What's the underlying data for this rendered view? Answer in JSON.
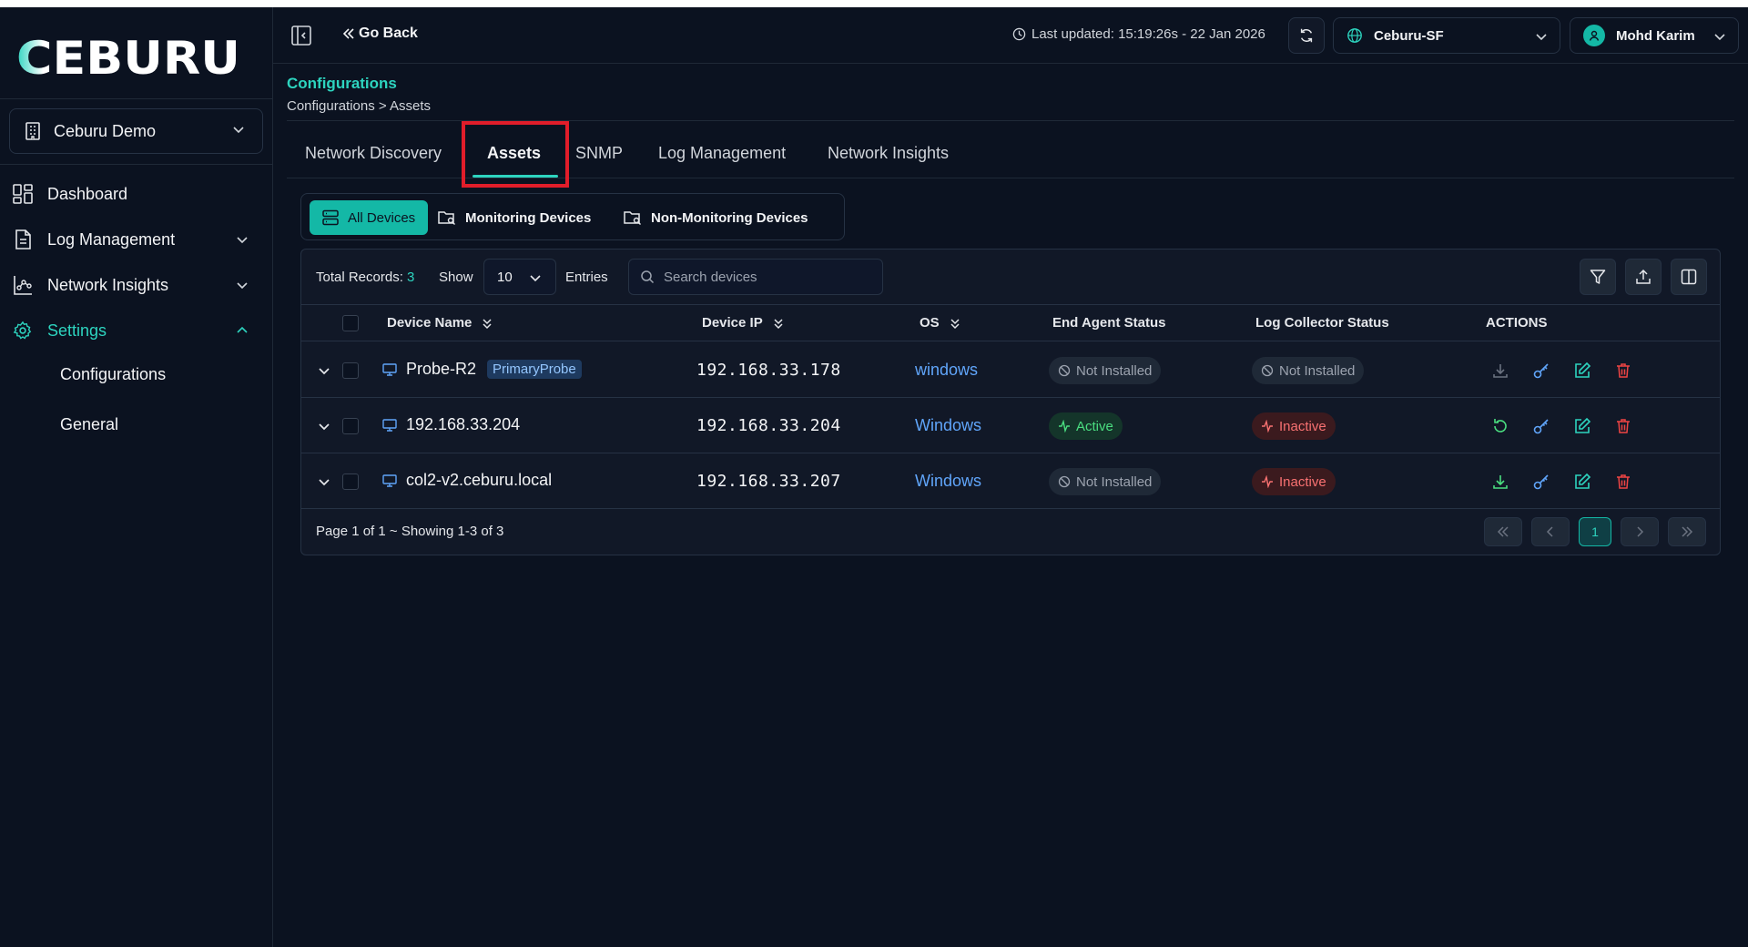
{
  "brand": {
    "logo_text": "CEBURU",
    "accent": "#2dd4bf"
  },
  "sidebar": {
    "org_selector": "Ceburu Demo",
    "items": [
      {
        "label": "Dashboard",
        "icon": "dashboard-icon"
      },
      {
        "label": "Log Management",
        "icon": "document-icon"
      },
      {
        "label": "Network Insights",
        "icon": "network-chart-icon"
      },
      {
        "label": "Settings",
        "icon": "gear-icon"
      }
    ],
    "sub_items": [
      {
        "label": "Configurations"
      },
      {
        "label": "General"
      }
    ]
  },
  "header": {
    "go_back": "Go Back",
    "last_updated": "Last updated: 15:19:26s - 22 Jan 2026",
    "site": "Ceburu-SF",
    "user": "Mohd Karim"
  },
  "page": {
    "title": "Configurations",
    "breadcrumb": [
      "Configurations",
      ">",
      "Assets"
    ]
  },
  "tabs": [
    {
      "label": "Network Discovery"
    },
    {
      "label": "Assets"
    },
    {
      "label": "SNMP"
    },
    {
      "label": "Log Management"
    },
    {
      "label": "Network Insights"
    }
  ],
  "segments": [
    {
      "label": "All Devices"
    },
    {
      "label": "Monitoring Devices"
    },
    {
      "label": "Non-Monitoring Devices"
    }
  ],
  "table": {
    "total_label": "Total Records:",
    "total_count": "3",
    "show_label": "Show",
    "page_size": "10",
    "entries_label": "Entries",
    "search_placeholder": "Search devices",
    "columns": [
      "Device Name",
      "Device IP",
      "OS",
      "End Agent Status",
      "Log Collector Status",
      "ACTIONS"
    ],
    "rows": [
      {
        "name": "Probe-R2",
        "badge": "PrimaryProbe",
        "ip": "192.168.33.178",
        "os": "windows",
        "agent": "Not Installed",
        "collector": "Not Installed"
      },
      {
        "name": "192.168.33.204",
        "badge": "",
        "ip": "192.168.33.204",
        "os": "Windows",
        "agent": "Active",
        "collector": "Inactive"
      },
      {
        "name": "col2-v2.ceburu.local",
        "badge": "",
        "ip": "192.168.33.207",
        "os": "Windows",
        "agent": "Not Installed",
        "collector": "Inactive"
      }
    ],
    "page_info": "Page 1 of 1 ~ Showing 1-3 of 3",
    "current_page": "1"
  }
}
